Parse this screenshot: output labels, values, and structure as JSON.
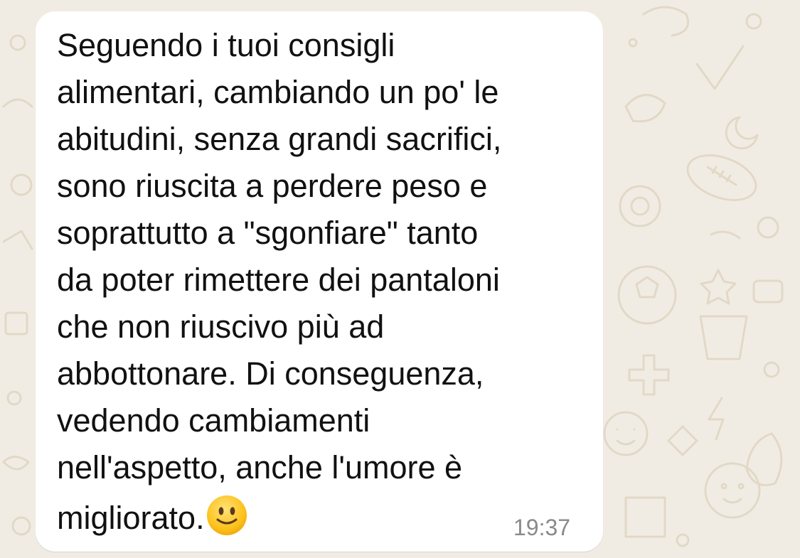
{
  "chat": {
    "background_color": "#f1ece3",
    "bubble_color": "#ffffff"
  },
  "message": {
    "lines": [
      "Seguendo i tuoi consigli",
      "alimentari, cambiando un po' le",
      "abitudini, senza grandi sacrifici,",
      "sono riuscita a perdere peso e",
      "soprattutto a \"sgonfiare\" tanto",
      "da poter rimettere dei pantaloni",
      "che non riuscivo più ad",
      "abbottonare.  Di conseguenza,",
      "vedendo cambiamenti",
      "nell'aspetto, anche l'umore è",
      "migliorato."
    ],
    "emoji": "slightly-smiling-face-icon",
    "timestamp": "19:37"
  }
}
